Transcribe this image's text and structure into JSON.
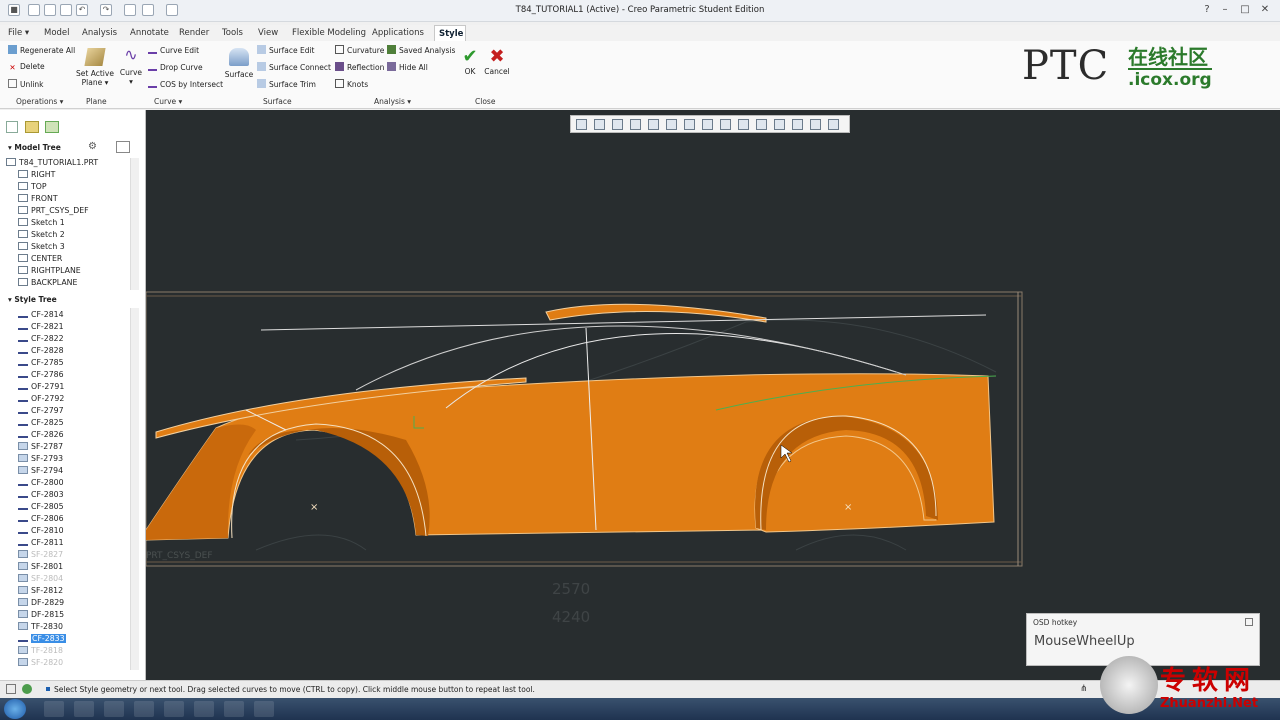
{
  "window": {
    "title": "T84_TUTORIAL1 (Active) - Creo Parametric Student Edition"
  },
  "menu": {
    "tabs": [
      "File",
      "Model",
      "Analysis",
      "Annotate",
      "Render",
      "Tools",
      "View",
      "Flexible Modeling",
      "Applications",
      "Style"
    ],
    "active": "Style"
  },
  "ribbon": {
    "operations": [
      "Regenerate All",
      "Delete",
      "Unlink"
    ],
    "set_active_plane": "Set Active Plane",
    "curve": "Curve",
    "curve_tools": [
      "Curve Edit",
      "Drop Curve",
      "COS by Intersect"
    ],
    "surface": "Surface",
    "surface_tools": [
      "Surface Edit",
      "Surface Connect",
      "Surface Trim"
    ],
    "analysis_tools": [
      "Curvature",
      "Reflection",
      "Knots"
    ],
    "analysis_tools2": [
      "Saved Analysis",
      "Hide All"
    ],
    "ok": "OK",
    "cancel": "Cancel",
    "groups": [
      "Operations",
      "Plane",
      "Curve",
      "Surface",
      "Analysis",
      "Close"
    ]
  },
  "logo": {
    "brand": "PTC",
    "cn": "在线社区",
    "url": ".icox.org"
  },
  "model_tree": {
    "title": "Model Tree",
    "items": [
      "T84_TUTORIAL1.PRT",
      "RIGHT",
      "TOP",
      "FRONT",
      "PRT_CSYS_DEF",
      "Sketch 1",
      "Sketch 2",
      "Sketch 3",
      "CENTER",
      "RIGHTPLANE",
      "BACKPLANE"
    ]
  },
  "style_tree": {
    "title": "Style Tree",
    "items": [
      "CF-2814",
      "CF-2821",
      "CF-2822",
      "CF-2828",
      "CF-2785",
      "CF-2786",
      "OF-2791",
      "OF-2792",
      "CF-2797",
      "CF-2825",
      "CF-2826",
      "SF-2787",
      "SF-2793",
      "SF-2794",
      "CF-2800",
      "CF-2803",
      "CF-2805",
      "CF-2806",
      "CF-2810",
      "CF-2811",
      "SF-2827",
      "SF-2801",
      "SF-2804",
      "SF-2812",
      "DF-2829",
      "DF-2815",
      "TF-2830",
      "CF-2833",
      "TF-2818",
      "SF-2820"
    ],
    "dim_items": [
      "SF-2827",
      "SF-2804",
      "TF-2818",
      "SF-2820"
    ],
    "selected": "CF-2833"
  },
  "viewport": {
    "csys_label": "PRT_CSYS_DEF",
    "dim1": "2570",
    "dim2": "4240",
    "colors": {
      "body": "#e07d14",
      "body_dark": "#b85f08",
      "bg": "#282d2f"
    }
  },
  "osd": {
    "title": "OSD hotkey",
    "value": "MouseWheelUp"
  },
  "status": {
    "text": "Select Style geometry or next tool. Drag selected curves to move (CTRL to copy). Click middle mouse button to repeat last tool."
  },
  "watermark": {
    "cn": "专软网",
    "url": "Zhuanzhi.Net"
  }
}
